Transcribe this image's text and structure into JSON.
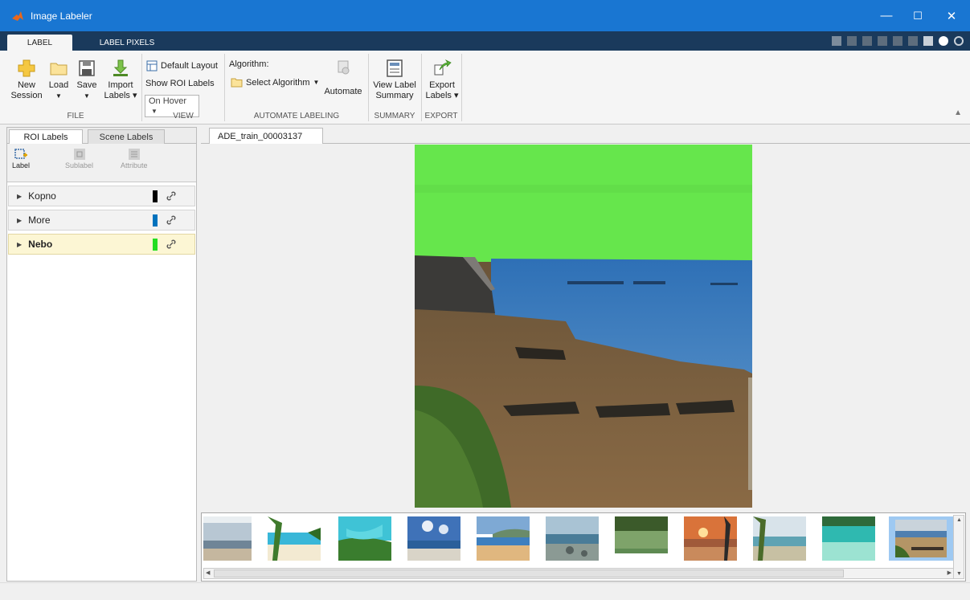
{
  "window": {
    "title": "Image Labeler",
    "controls": {
      "minimize": "—",
      "maximize": "☐",
      "close": "✕"
    }
  },
  "tabs": [
    {
      "label": "LABEL",
      "active": true
    },
    {
      "label": "LABEL PIXELS",
      "active": false
    }
  ],
  "ribbon": {
    "file": {
      "group_label": "FILE",
      "new_session": [
        "New",
        "Session"
      ],
      "load": [
        "Load",
        "▼"
      ],
      "save": [
        "Save",
        "▼"
      ],
      "import": [
        "Import",
        "Labels ▾"
      ]
    },
    "view": {
      "group_label": "VIEW",
      "default_layout": "Default Layout",
      "show_roi_labels": "Show ROI Labels",
      "roi_mode": "On Hover"
    },
    "automate": {
      "group_label": "AUTOMATE LABELING",
      "algorithm_label": "Algorithm:",
      "select_algorithm": "Select Algorithm",
      "automate": "Automate"
    },
    "summary": {
      "group_label": "SUMMARY",
      "view_label_summary": [
        "View Label",
        "Summary"
      ]
    },
    "export": {
      "group_label": "EXPORT",
      "export_labels": [
        "Export",
        "Labels ▾"
      ]
    }
  },
  "left_panel": {
    "tabs": [
      "ROI Labels",
      "Scene Labels"
    ],
    "tools": [
      {
        "label": "Label",
        "enabled": true
      },
      {
        "label": "Sublabel",
        "enabled": false
      },
      {
        "label": "Attribute",
        "enabled": false
      }
    ],
    "labels": [
      {
        "name": "Kopno",
        "color": "#000000",
        "selected": false
      },
      {
        "name": "More",
        "color": "#0072bd",
        "selected": false
      },
      {
        "name": "Nebo",
        "color": "#22dd22",
        "selected": true
      }
    ]
  },
  "image_tab": "ADE_train_00003137",
  "filmstrip": {
    "count": 11,
    "selected_index": 10
  },
  "colors": {
    "titlebar": "#1976d2",
    "tabstrip": "#1a3a5c",
    "sky_overlay": "#66e64c",
    "sea_overlay": "#3b78b8",
    "selected_label_bg": "#fcf6d4"
  }
}
